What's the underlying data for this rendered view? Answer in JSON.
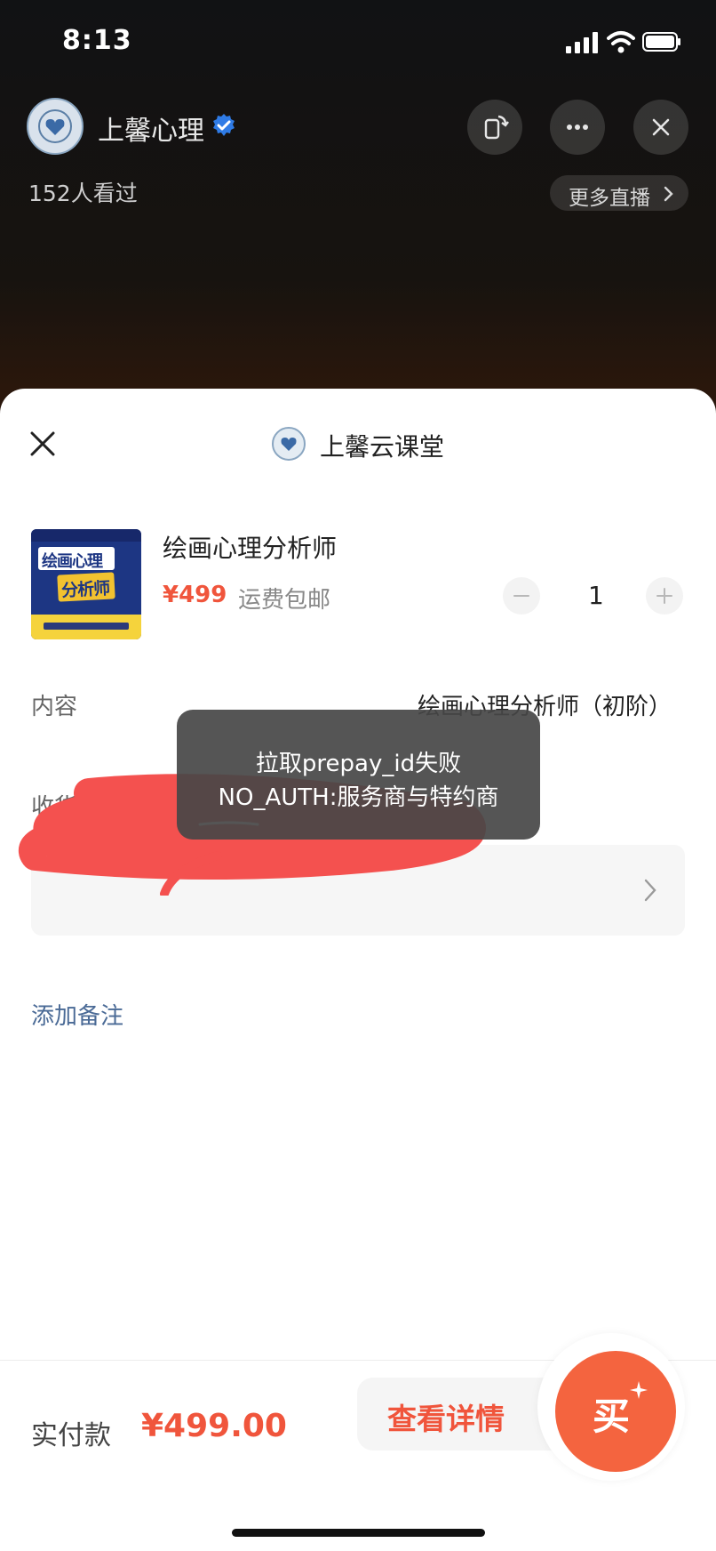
{
  "status_bar": {
    "time": "8:13"
  },
  "live": {
    "channel_name": "上馨心理",
    "viewers": "152人看过",
    "more_live_label": "更多直播"
  },
  "sheet": {
    "shop_name": "上馨云课堂",
    "product": {
      "title": "绘画心理分析师",
      "image_text_top": "绘画心理",
      "image_text_bottom": "分析师",
      "price": "¥499",
      "shipping": "运费包邮",
      "quantity": "1"
    },
    "content_label": "内容",
    "content_value": "绘画心理分析师（初阶）",
    "address_label": "收货地址",
    "remark_link": "添加备注",
    "footer": {
      "pay_label": "实付款",
      "pay_amount": "¥499.00",
      "details_button": "查看详情",
      "buy_button": "买"
    }
  },
  "toast": {
    "line1": "拉取prepay_id失败",
    "line2": "NO_AUTH:服务商与特约商"
  },
  "colors": {
    "accent_red": "#f0553c",
    "buy_orange": "#f4643f",
    "link_blue": "#4a6a96",
    "redaction": "#f4514f"
  },
  "icons": [
    "signal-icon",
    "wifi-icon",
    "battery-icon",
    "verified-icon",
    "rotate-screen-icon",
    "more-icon",
    "close-icon",
    "chevron-right-icon",
    "minus-icon",
    "plus-icon",
    "sparkle-icon"
  ]
}
